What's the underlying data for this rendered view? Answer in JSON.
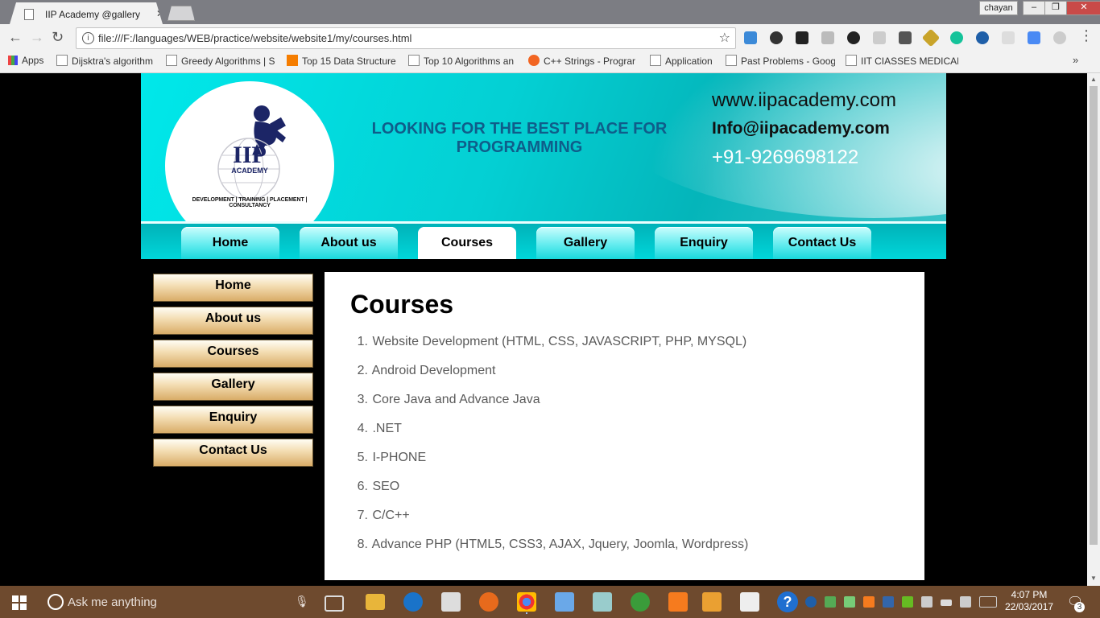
{
  "browser": {
    "tab_title": "IIP Academy @gallery",
    "tab_close": "✕",
    "profile_name": "chayan",
    "url": "file:///F:/languages/WEB/practice/website/website1/my/courses.html",
    "bookmarks": [
      "Apps",
      "Dijsktra's algorithm",
      "Greedy Algorithms | S",
      "Top 15 Data Structure",
      "Top 10 Algorithms an",
      "C++ Strings - Prograr",
      "Application",
      "Past Problems - Goog",
      "IIT CIASSES MEDICAL"
    ],
    "window_controls": [
      "–",
      "❐",
      "✕"
    ]
  },
  "header": {
    "logo_brand": "IIP",
    "logo_sub": "ACADEMY",
    "logo_tagline": "DEVELOPMENT | TRAINING | PLACEMENT | CONSULTANCY",
    "tagline": "LOOKING FOR THE BEST PLACE FOR PROGRAMMING",
    "website": "www.iipacademy.com",
    "email": "Info@iipacademy.com",
    "phone": "+91-9269698122"
  },
  "top_nav": [
    "Home",
    "About us",
    "Courses",
    "Gallery",
    "Enquiry",
    "Contact Us"
  ],
  "top_nav_active": "Courses",
  "side_nav": [
    "Home",
    "About us",
    "Courses",
    "Gallery",
    "Enquiry",
    "Contact Us"
  ],
  "content": {
    "title": "Courses",
    "courses": [
      {
        "num": "1.",
        "text": "Website Development (HTML, CSS, JAVASCRIPT, PHP, MYSQL)"
      },
      {
        "num": "2.",
        "text": "Android Development"
      },
      {
        "num": "3.",
        "text": "Core Java and Advance Java"
      },
      {
        "num": "4.",
        "text": ".NET"
      },
      {
        "num": "5.",
        "text": "I-PHONE"
      },
      {
        "num": "6.",
        "text": "SEO"
      },
      {
        "num": "7.",
        "text": "C/C++"
      },
      {
        "num": "8.",
        "text": "Advance PHP (HTML5, CSS3, AJAX, Jquery, Joomla, Wordpress)"
      }
    ]
  },
  "taskbar": {
    "search_placeholder": "Ask me anything",
    "time": "4:07 PM",
    "date": "22/03/2017",
    "notification_count": "3"
  },
  "colors": {
    "header_cyan": "#04cfd3",
    "tagline_blue": "#0f5d8a",
    "sidenav_tan": "#d9ac68",
    "taskbar_brown": "#6e4a2e"
  }
}
